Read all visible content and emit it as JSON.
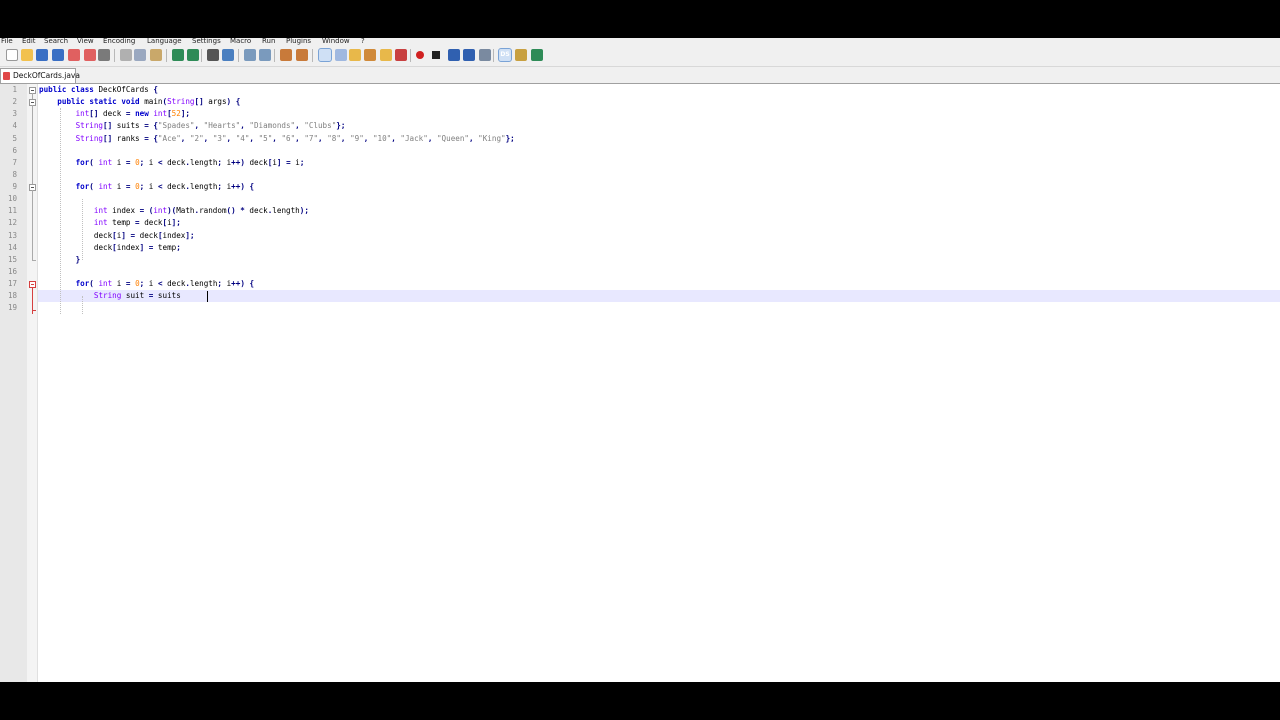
{
  "menu": [
    "File",
    "Edit",
    "Search",
    "View",
    "Encoding",
    "Language",
    "Settings",
    "Macro",
    "Run",
    "Plugins",
    "Window",
    "?"
  ],
  "toolbar": {
    "buttons": [
      "new-file",
      "open-file",
      "save",
      "save-all",
      "close",
      "close-all",
      "print",
      "cut",
      "copy",
      "paste",
      "undo",
      "redo",
      "find",
      "replace",
      "zoom-in",
      "zoom-out",
      "sync-vertical",
      "sync-horizontal",
      "word-wrap",
      "show-all-chars",
      "indent-guide",
      "user-language",
      "function-list",
      "folder-as-workspace",
      "record-macro",
      "stop-recording",
      "playback-macro",
      "run-macro-multiple",
      "save-macro",
      "ds-plugin",
      "plugin-2",
      "spell-check"
    ],
    "ds_label": "DS"
  },
  "tab": {
    "label": "DeckOfCards.java",
    "icon": "file-modified-icon"
  },
  "editor": {
    "current_line": 18,
    "lines": [
      {
        "n": "1",
        "text": "public class DeckOfCards {"
      },
      {
        "n": "2",
        "text": "    public static void main(String[] args) {"
      },
      {
        "n": "3",
        "text": "        int[] deck = new int[52];"
      },
      {
        "n": "4",
        "text": "        String[] suits = {\"Spades\", \"Hearts\", \"Diamonds\", \"Clubs\"};"
      },
      {
        "n": "5",
        "text": "        String[] ranks = {\"Ace\", \"2\", \"3\", \"4\", \"5\", \"6\", \"7\", \"8\", \"9\", \"10\", \"Jack\", \"Queen\", \"King\"};"
      },
      {
        "n": "6",
        "text": ""
      },
      {
        "n": "7",
        "text": "        for( int i = 0; i < deck.length; i++) deck[i] = i;"
      },
      {
        "n": "8",
        "text": ""
      },
      {
        "n": "9",
        "text": "        for( int i = 0; i < deck.length; i++) {"
      },
      {
        "n": "10",
        "text": ""
      },
      {
        "n": "11",
        "text": "            int index = (int)(Math.random() * deck.length);"
      },
      {
        "n": "12",
        "text": "            int temp = deck[i];"
      },
      {
        "n": "13",
        "text": "            deck[i] = deck[index];"
      },
      {
        "n": "14",
        "text": "            deck[index] = temp;"
      },
      {
        "n": "15",
        "text": "        }"
      },
      {
        "n": "16",
        "text": ""
      },
      {
        "n": "17",
        "text": "        for( int i = 0; i < deck.length; i++) {"
      },
      {
        "n": "18",
        "text": "            String suit = suits"
      },
      {
        "n": "19",
        "text": ""
      }
    ]
  },
  "colors": {
    "keyword": "#0000cc",
    "type": "#8000ff",
    "string": "#808080",
    "number": "#ff8000",
    "current_line": "#e8e8ff"
  }
}
